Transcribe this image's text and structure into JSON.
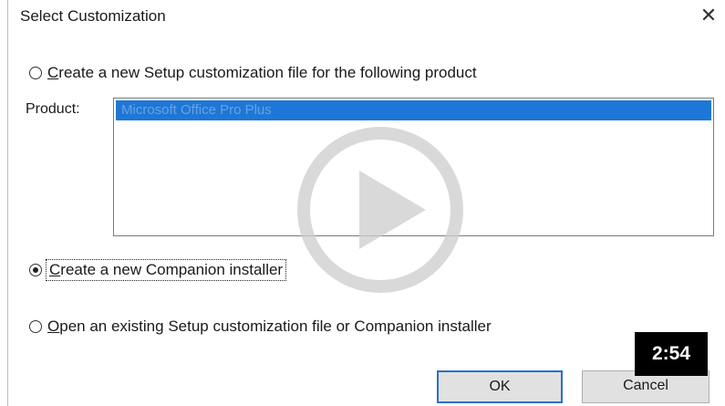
{
  "dialog": {
    "title": "Select Customization",
    "close_glyph": "✕"
  },
  "options": [
    {
      "prefix": "",
      "accel": "C",
      "rest": "reate a new Setup customization file for the following product",
      "checked": false
    },
    {
      "prefix": "",
      "accel": "C",
      "rest": "reate a new Companion installer",
      "checked": true
    },
    {
      "prefix": "",
      "accel": "O",
      "rest": "pen an existing Setup customization file or Companion installer",
      "checked": false
    }
  ],
  "product": {
    "label": "Product:",
    "selected_item": "Microsoft Office Pro Plus"
  },
  "buttons": {
    "ok": "OK",
    "cancel": "Cancel"
  },
  "video_overlay": {
    "icon": "play-icon",
    "duration": "2:54"
  },
  "colors": {
    "selection": "#1e77d6",
    "ok_border": "#2a6fcf",
    "overlay": "#cccccc"
  }
}
